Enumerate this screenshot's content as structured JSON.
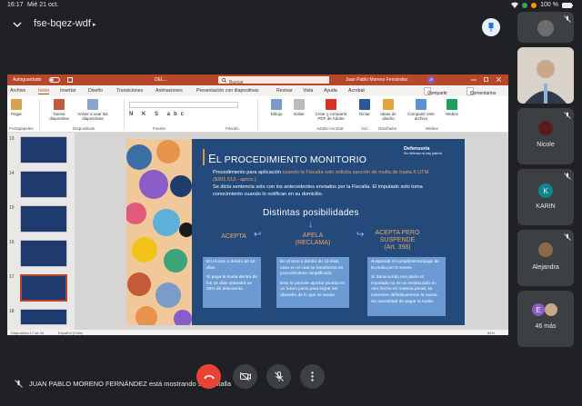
{
  "status_bar": {
    "time": "16:17",
    "date": "Mié 21 oct.",
    "battery": "100 %"
  },
  "meeting": {
    "room_code": "fse-bqez-wdf",
    "room_arrow": "▸"
  },
  "ppt": {
    "autosave": "Autoguardado",
    "doc_name": "DEL...",
    "search": "Buscar",
    "user": "Juan Pablo Moreno Fernández",
    "user_initials": "JP",
    "tabs": [
      "Archivo",
      "Inicio",
      "Insertar",
      "Diseño",
      "Transiciones",
      "Animaciones",
      "Presentación con diapositivas",
      "Revisar",
      "Vista",
      "Ayuda",
      "Acrobat"
    ],
    "share": "Compartir",
    "comments": "Comentarios",
    "ribbon": {
      "paste": "Pegar",
      "new_slide": "Nueva diapositiva",
      "reuse": "Volver a usar las diapositivas",
      "draw": "Dibujo",
      "edit": "Editar",
      "create_pdf": "Crear y compartir PDF de Adobe",
      "dictate": "Dictar",
      "ideas": "Ideas de diseño",
      "share_file": "Compartir este archivo",
      "webex": "Webex",
      "groups": [
        "Portapapeles",
        "Diapositivas",
        "Fuente",
        "Párrafo",
        "Adobe Acrobat",
        "Voz",
        "Diseñador",
        "Webex"
      ]
    },
    "thumb_numbers": [
      "13",
      "14",
      "15",
      "16",
      "17",
      "18"
    ],
    "status_slide": "Diapositiva 17 de 18",
    "status_lang": "Español (Chile)",
    "status_zoom": "64%"
  },
  "slide": {
    "title_first": "E",
    "title_rest": "L PROCEDIMIENTO MONITORIO",
    "logo": "Defensoría",
    "logo_sub": "Sin defensa no hay justicia",
    "intro_pre": "Procedimiento para aplicación ",
    "intro_hl": "cuando la Fiscalía solo solicita sanción de multa de hasta 6 UTM ($301.512.- aprox.).",
    "intro_post": "Se dicta sentencia solo con los antecedentes enviados por la Fiscalía. El imputado solo toma conocimiento cuando lo notifican en su domicilio.",
    "subtitle": "Distintas posibilidades",
    "cols": [
      {
        "head": "ACEPTA",
        "p1": "En el acto o dentro de 15 días.",
        "p2": "Si paga la multa dentro de los 15 días obtendrá un 25% de descuento."
      },
      {
        "head": "APELA (RECLAMA)",
        "p1": "En el acto o dentro de 15 días, caso en el cual se transforma en procedimiento simplificado.",
        "p2": "Esto le permite aportar prueba en un futuro juicio para lograr ser absuelto de lo que se acusa."
      },
      {
        "head": "ACEPTA PERO SUSPENDE (Art. 398)",
        "p1": "Suspende el cumplimiento/pago de la multa por 6 meses.",
        "p2": "Si transcurrido ese plazo el imputado no se ve involucrado en otro hecho en materia penal, se sobresee definitivamente la causa sin necesidad de pagar la multa."
      }
    ]
  },
  "participants": [
    {
      "name": ""
    },
    {
      "name": ""
    },
    {
      "name": "Nicole"
    },
    {
      "name": "KARIN",
      "initial": "K"
    },
    {
      "name": "Alejandra"
    },
    {
      "name": "46 más",
      "initial": "E"
    }
  ],
  "bottom": {
    "presenting": "JUAN PABLO MORENO FERNÁNDEZ está mostrando su pantalla"
  },
  "colors": {
    "ppt_accent": "#b7472a",
    "slide_bg": "#244a7c",
    "orange": "#f0a35e",
    "end_call": "#ea4335",
    "box": "#6b9bd2"
  }
}
